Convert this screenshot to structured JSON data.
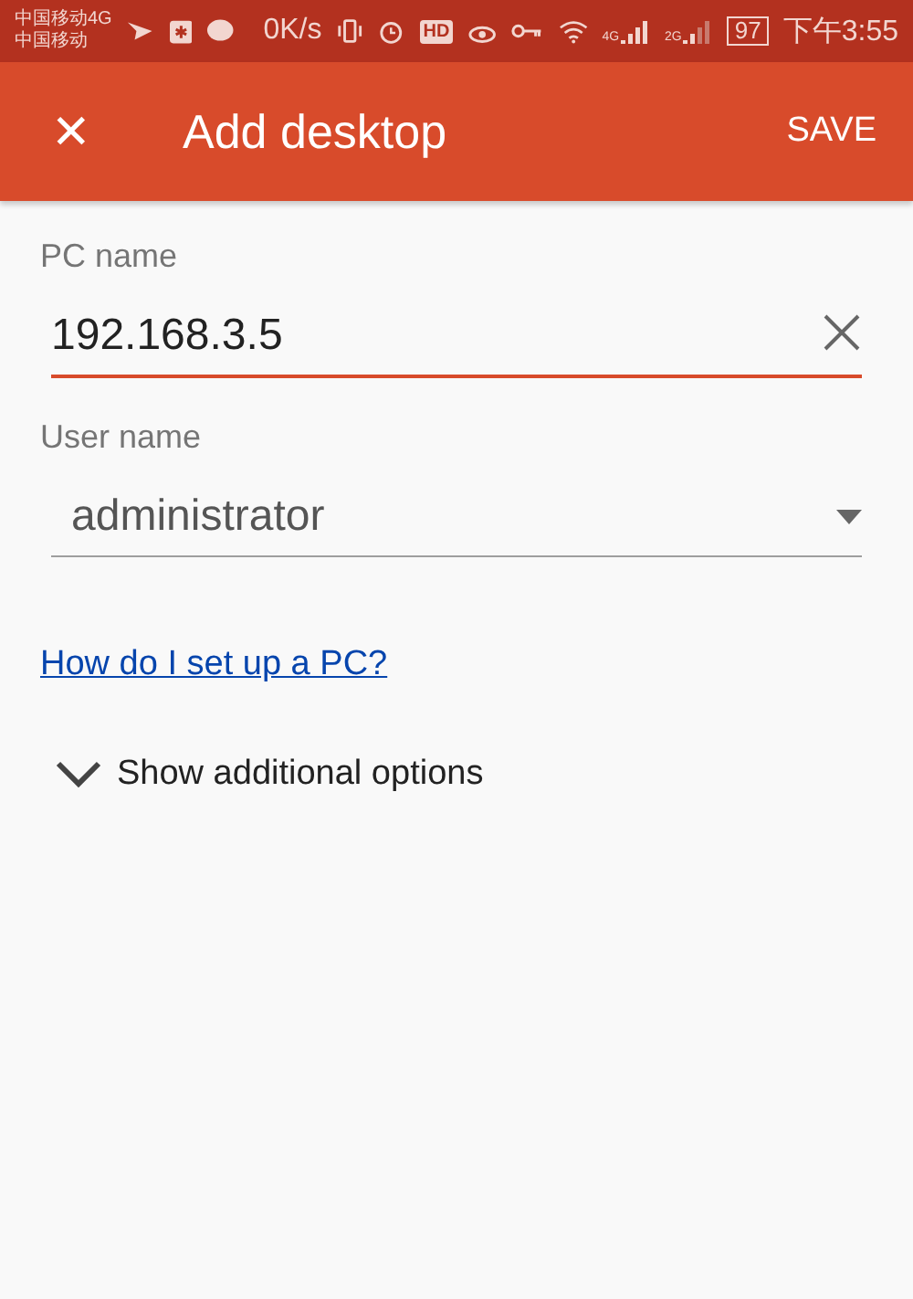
{
  "status_bar": {
    "carriers": [
      "中国移动4G",
      "中国移动"
    ],
    "speed": "0K/s",
    "hd": "HD",
    "signals": [
      "4G",
      "2G"
    ],
    "battery": "97",
    "time": "下午3:55"
  },
  "app_bar": {
    "close": "✕",
    "title": "Add desktop",
    "action": "SAVE"
  },
  "fields": [
    {
      "kind": "text",
      "label": "PC name",
      "value": "192.168.3.5",
      "focused": true
    },
    {
      "kind": "select",
      "label": "User name",
      "value": "administrator",
      "focused": false
    }
  ],
  "help_link": "How do I set up a PC?",
  "options": {
    "label": "Show additional options",
    "expanded": false
  }
}
